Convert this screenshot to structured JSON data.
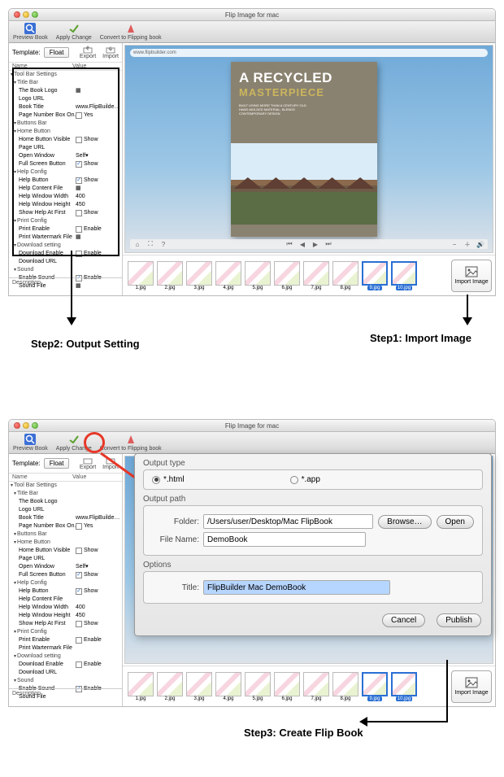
{
  "window": {
    "title": "Flip Image for mac"
  },
  "toolbar": {
    "preview": "Preview Book",
    "apply": "Apply Change",
    "convert": "Convert to Flipping book"
  },
  "template": {
    "label": "Template:",
    "value": "Float",
    "export": "Export",
    "import": "Import"
  },
  "columns": {
    "name": "Name",
    "value": "Value"
  },
  "settings": {
    "toolbar_group": "Tool Bar Settings",
    "titlebar": "Title Bar",
    "the_book_logo": "The Book Logo",
    "logo_url": "Logo URL",
    "book_title": "Book Title",
    "book_title_val": "www.FlipBuilde…",
    "page_number_box": "Page Number Box On…",
    "yes": "Yes",
    "buttons_bar": "Buttons Bar",
    "home_button": "Home Button",
    "home_button_visible": "Home Button Visible",
    "show": "Show",
    "page_url": "Page URL",
    "open_window": "Open Window",
    "self": "Self",
    "full_screen_button": "Full Screen Button",
    "help_config": "Help Config",
    "help_button": "Help Button",
    "help_content_file": "Help Content File",
    "help_window_width": "Help Window Width",
    "hw_width_val": "400",
    "help_window_height": "Help Window Height",
    "hw_height_val": "450",
    "show_help_first": "Show Help At First",
    "print_config": "Print Config",
    "print_enable": "Print Enable",
    "enable": "Enable",
    "print_watermark": "Print Wartermark File",
    "download_setting": "Download setting",
    "download_enable": "Download Enable",
    "download_url": "Download URL",
    "sound": "Sound",
    "enable_sound": "Enable Sound",
    "sound_file": "Sound File"
  },
  "description_label": "Description",
  "urlbar": "www.flipbuilder.com",
  "book": {
    "title1": "A RECYCLED",
    "title2": "MASTERPIECE",
    "blurb": "BUILT USING MORE THAN A CENTURY OLD HAND-MOLDED MATERIAL, BLENDS CONTEMPORARY DESIGN"
  },
  "thumbs": [
    "1.jpg",
    "2.jpg",
    "3.jpg",
    "4.jpg",
    "5.jpg",
    "6.jpg",
    "7.jpg",
    "8.jpg",
    "9.jpg",
    "10.jpg"
  ],
  "import_image": "Import Image",
  "steps": {
    "s1": "Step1: Import Image",
    "s2": "Step2: Output Setting",
    "s3": "Step3: Create Flip Book"
  },
  "dialog": {
    "output_type": "Output type",
    "opt_html": "*.html",
    "opt_app": "*.app",
    "output_path": "Output path",
    "folder_label": "Folder:",
    "folder_value": "/Users/user/Desktop/Mac FlipBook",
    "browse": "Browse…",
    "open": "Open",
    "filename_label": "File Name:",
    "filename_value": "DemoBook",
    "options": "Options",
    "title_label": "Title:",
    "title_value": "FlipBuilder Mac DemoBook",
    "cancel": "Cancel",
    "publish": "Publish"
  }
}
